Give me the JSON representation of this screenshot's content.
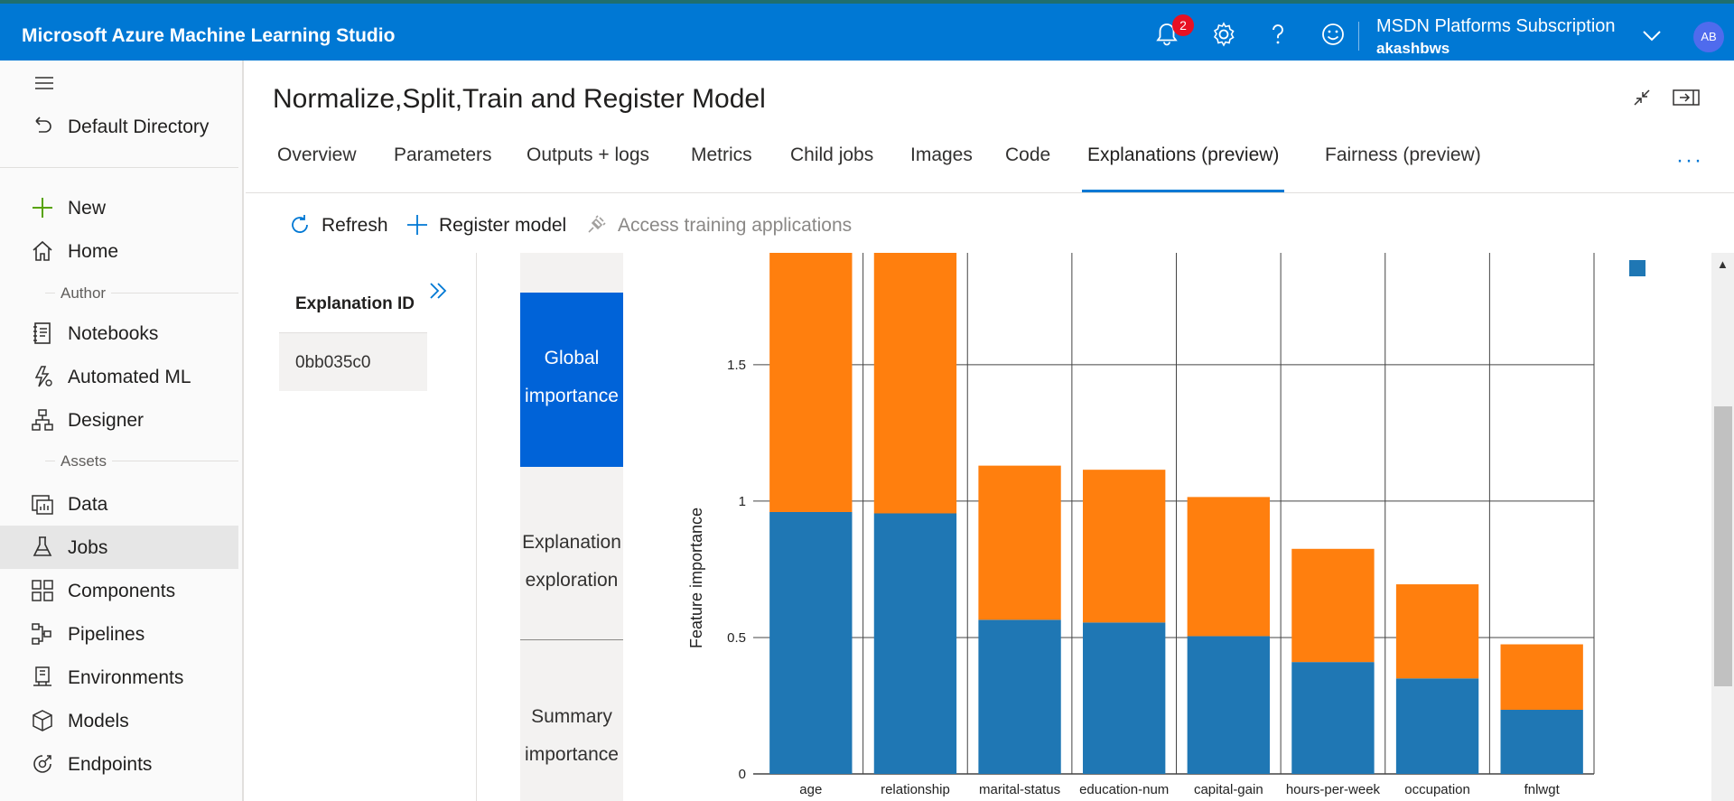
{
  "app": {
    "title": "Microsoft Azure Machine Learning Studio",
    "notifications_count": "2",
    "subscription": "MSDN Platforms Subscription",
    "workspace": "akashbws",
    "avatar_initials": "AB",
    "accent": "#0078d4"
  },
  "nav": {
    "directory": "Default Directory",
    "new": "New",
    "home": "Home",
    "group_author": "Author",
    "notebooks": "Notebooks",
    "automated_ml": "Automated ML",
    "designer": "Designer",
    "group_assets": "Assets",
    "data": "Data",
    "jobs": "Jobs",
    "components": "Components",
    "pipelines": "Pipelines",
    "environments": "Environments",
    "models": "Models",
    "endpoints": "Endpoints"
  },
  "page": {
    "title": "Normalize,Split,Train and Register Model",
    "tabs": [
      {
        "label": "Overview"
      },
      {
        "label": "Parameters"
      },
      {
        "label": "Outputs + logs"
      },
      {
        "label": "Metrics"
      },
      {
        "label": "Child jobs"
      },
      {
        "label": "Images"
      },
      {
        "label": "Code"
      },
      {
        "label": "Explanations (preview)"
      },
      {
        "label": "Fairness (preview)"
      }
    ],
    "active_tab": "Explanations (preview)",
    "more": "···"
  },
  "commands": {
    "refresh": "Refresh",
    "register_model": "Register model",
    "access_training_applications": "Access training applications"
  },
  "explanation": {
    "id_label": "Explanation ID",
    "id_value": "0bb035c0"
  },
  "views": {
    "global_1": "Global",
    "global_2": "importance",
    "exploration_1": "Explanation",
    "exploration_2": "exploration",
    "summary_1": "Summary",
    "summary_2": "importance"
  },
  "chart_data": {
    "type": "bar",
    "stacked": true,
    "ylabel": "Feature importance",
    "xlabel": "",
    "categories": [
      "age",
      "relationship",
      "marital-status",
      "education-num",
      "capital-gain",
      "hours-per-week",
      "occupation",
      "fnlwgt"
    ],
    "series": [
      {
        "color": "#1f77b4",
        "values": [
          0.96,
          0.955,
          0.565,
          0.555,
          0.505,
          0.41,
          0.35,
          0.235
        ]
      },
      {
        "color": "#ff7f0e",
        "values": [
          1.0,
          0.98,
          0.565,
          0.56,
          0.51,
          0.415,
          0.345,
          0.24
        ]
      }
    ],
    "yticks": [
      "0",
      "0.5",
      "1",
      "1.5"
    ],
    "ylim": [
      0,
      1.91
    ],
    "grid": true
  }
}
